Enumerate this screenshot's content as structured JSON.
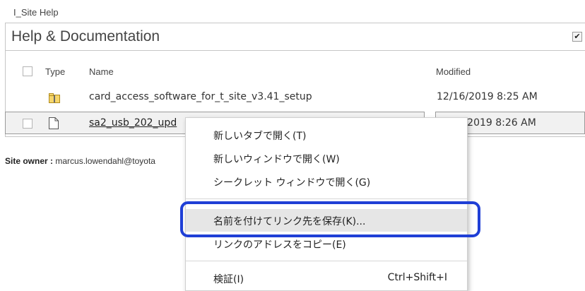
{
  "breadcrumb": "I_Site Help",
  "panel": {
    "title": "Help & Documentation",
    "title_check": "✔"
  },
  "columns": {
    "type": "Type",
    "name": "Name",
    "modified": "Modified"
  },
  "rows": [
    {
      "name": "card_access_software_for_t_site_v3.41_setup",
      "modified": "12/16/2019 8:25 AM",
      "icon": "folder-zip-icon"
    },
    {
      "name": "sa2_usb_202_upd",
      "modified": "2/16/2019 8:26 AM",
      "icon": "document-icon"
    }
  ],
  "site_owner": {
    "label": "Site owner :",
    "value": "marcus.lowendahl@toyota"
  },
  "context_menu": {
    "items": [
      {
        "label": "新しいタブで開く(T)"
      },
      {
        "label": "新しいウィンドウで開く(W)"
      },
      {
        "label": "シークレット ウィンドウで開く(G)"
      },
      {
        "label": "名前を付けてリンク先を保存(K)..."
      },
      {
        "label": "リンクのアドレスをコピー(E)"
      },
      {
        "label": "検証(I)",
        "shortcut": "Ctrl+Shift+I"
      }
    ]
  },
  "colors": {
    "highlight": "#1f3fd6",
    "menu_hover": "#e6e6e6"
  }
}
